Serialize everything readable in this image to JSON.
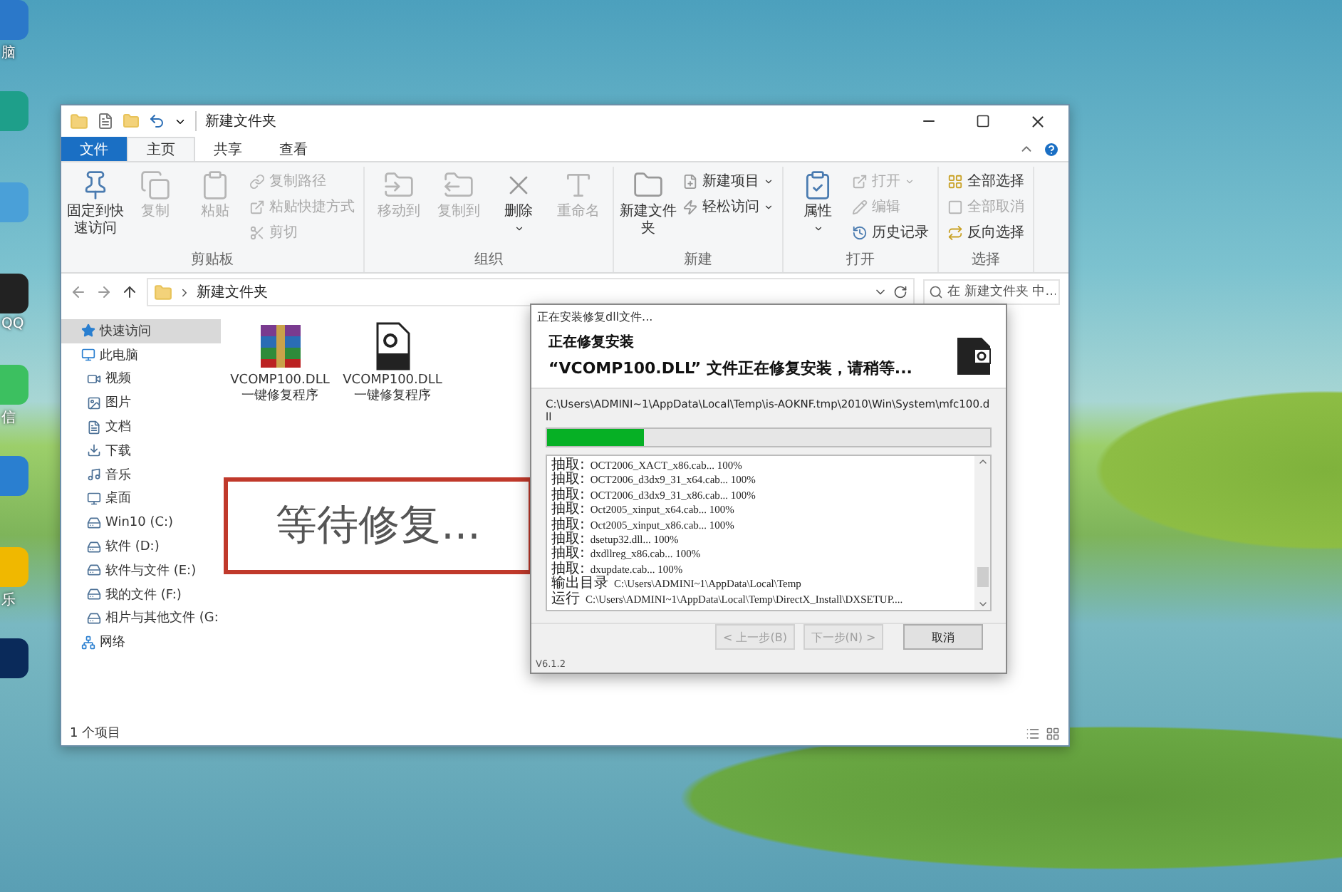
{
  "desktop_icons": [
    {
      "kind": "app",
      "label": "脑"
    },
    {
      "kind": "app"
    },
    {
      "kind": "app"
    },
    {
      "kind": "app",
      "label": "QQ"
    },
    {
      "kind": "app",
      "label": "信"
    },
    {
      "kind": "app"
    },
    {
      "kind": "app",
      "label": "乐"
    },
    {
      "kind": "app"
    }
  ],
  "explorer": {
    "title": "新建文件夹",
    "tabs": [
      {
        "label": "文件",
        "kind": "file",
        "selected": false
      },
      {
        "label": "主页",
        "kind": "tab",
        "selected": true
      },
      {
        "label": "共享",
        "kind": "tab",
        "selected": false
      },
      {
        "label": "查看",
        "kind": "tab",
        "selected": false
      }
    ],
    "ribbon": [
      {
        "label": "剪贴板",
        "items": [
          {
            "label": "固定到快速访问",
            "kind": "large",
            "disabled": false,
            "menu": false
          },
          {
            "label": "复制",
            "kind": "large",
            "disabled": true,
            "menu": false
          },
          {
            "label": "粘贴",
            "kind": "large",
            "disabled": true,
            "menu": false
          },
          {
            "label": "复制路径",
            "kind": "small",
            "disabled": true,
            "menu": false
          },
          {
            "label": "粘贴快捷方式",
            "kind": "small",
            "disabled": true,
            "menu": false
          },
          {
            "label": "剪切",
            "kind": "small",
            "disabled": true,
            "menu": false
          }
        ]
      },
      {
        "label": "组织",
        "items": [
          {
            "label": "移动到",
            "kind": "large",
            "disabled": true,
            "menu": false
          },
          {
            "label": "复制到",
            "kind": "large",
            "disabled": true,
            "menu": false
          },
          {
            "label": "删除",
            "kind": "large",
            "disabled": false,
            "menu": true
          },
          {
            "label": "重命名",
            "kind": "large",
            "disabled": true,
            "menu": false
          }
        ]
      },
      {
        "label": "新建",
        "items": [
          {
            "label": "新建文件夹",
            "kind": "large",
            "disabled": false,
            "menu": false
          },
          {
            "label": "新建项目",
            "kind": "small",
            "disabled": false,
            "menu": true
          },
          {
            "label": "轻松访问",
            "kind": "small",
            "disabled": false,
            "menu": true
          }
        ]
      },
      {
        "label": "打开",
        "items": [
          {
            "label": "属性",
            "kind": "large",
            "disabled": false,
            "menu": true
          },
          {
            "label": "打开",
            "kind": "small",
            "disabled": true,
            "menu": true
          },
          {
            "label": "编辑",
            "kind": "small",
            "disabled": true,
            "menu": false
          },
          {
            "label": "历史记录",
            "kind": "small",
            "disabled": false,
            "menu": false
          }
        ]
      },
      {
        "label": "选择",
        "items": [
          {
            "label": "全部选择",
            "kind": "small",
            "disabled": false,
            "menu": false
          },
          {
            "label": "全部取消",
            "kind": "small",
            "disabled": true,
            "menu": false
          },
          {
            "label": "反向选择",
            "kind": "small",
            "disabled": false,
            "menu": false
          }
        ]
      }
    ],
    "address": {
      "path": "新建文件夹",
      "search_placeholder": "在 新建文件夹 中..."
    },
    "nav": [
      {
        "label": "快速访问",
        "selected": true
      },
      {
        "label": "此电脑",
        "selected": false,
        "children": [
          {
            "label": "视频",
            "selected": false
          },
          {
            "label": "图片",
            "selected": false
          },
          {
            "label": "文档",
            "selected": false
          },
          {
            "label": "下载",
            "selected": false
          },
          {
            "label": "音乐",
            "selected": false
          },
          {
            "label": "桌面",
            "selected": false
          },
          {
            "label": "Win10 (C:)",
            "selected": false
          },
          {
            "label": "软件 (D:)",
            "selected": false
          },
          {
            "label": "软件与文件 (E:)",
            "selected": false
          },
          {
            "label": "我的文件 (F:)",
            "selected": false
          },
          {
            "label": "相片与其他文件 (G:",
            "selected": false
          }
        ]
      },
      {
        "label": "网络",
        "selected": false
      }
    ],
    "files": [
      {
        "name": "VCOMP100.DLL\n一键修复程序",
        "kind": "archive"
      },
      {
        "name": "VCOMP100.DLL\n一键修复程序",
        "kind": "dll"
      }
    ],
    "notice": "等待修复...",
    "status": "1 个项目"
  },
  "dialog": {
    "title": "正在安装修复dll文件...",
    "heading": "正在修复安装",
    "message": "“VCOMP100.DLL” 文件正在修复安装，请稍等...",
    "path": "C:\\Users\\ADMINI~1\\AppData\\Local\\Temp\\is-AOKNF.tmp\\2010\\Win\\System\\mfc100.dll",
    "progress": {
      "level": 0.22
    },
    "log": [
      {
        "label": "抽取:",
        "text": "OCT2006_XACT_x86.cab... 100%"
      },
      {
        "label": "抽取:",
        "text": "OCT2006_d3dx9_31_x64.cab... 100%"
      },
      {
        "label": "抽取:",
        "text": "OCT2006_d3dx9_31_x86.cab... 100%"
      },
      {
        "label": "抽取:",
        "text": "Oct2005_xinput_x64.cab... 100%"
      },
      {
        "label": "抽取:",
        "text": "Oct2005_xinput_x86.cab... 100%"
      },
      {
        "label": "抽取:",
        "text": "dsetup32.dll... 100%"
      },
      {
        "label": "抽取:",
        "text": "dxdllreg_x86.cab... 100%"
      },
      {
        "label": "抽取:",
        "text": "dxupdate.cab... 100%"
      },
      {
        "label": "输出目录",
        "text": "C:\\Users\\ADMINI~1\\AppData\\Local\\Temp"
      },
      {
        "label": "运行",
        "text": "C:\\Users\\ADMINI~1\\AppData\\Local\\Temp\\DirectX_Install\\DXSETUP...."
      }
    ],
    "buttons": [
      {
        "label": "< 上一步(B)",
        "disabled": true
      },
      {
        "label": "下一步(N) >",
        "disabled": true
      },
      {
        "label": "取消",
        "disabled": false
      }
    ],
    "version": "V6.1.2"
  }
}
